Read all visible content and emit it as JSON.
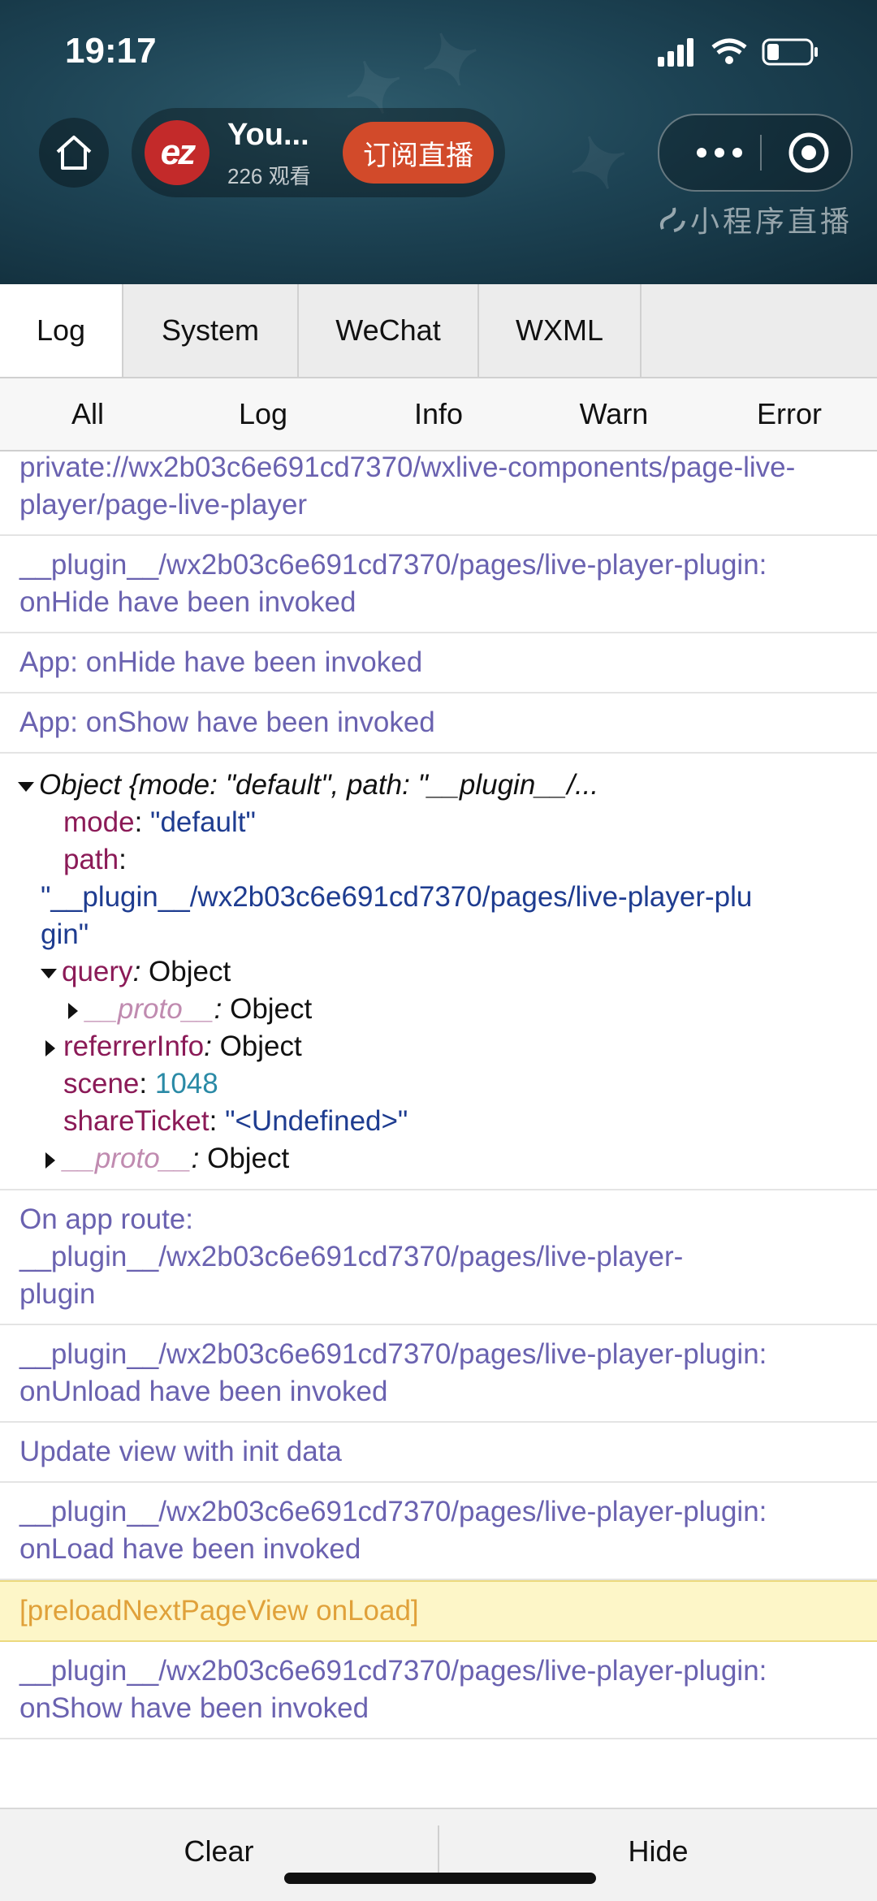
{
  "status": {
    "time": "19:17"
  },
  "live": {
    "name": "You...",
    "viewers": "226 观看",
    "subscribe_label": "订阅直播",
    "mini_label": "小程序直播",
    "avatar_text": "ez"
  },
  "tabs": [
    {
      "label": "Log",
      "active": true
    },
    {
      "label": "System",
      "active": false
    },
    {
      "label": "WeChat",
      "active": false
    },
    {
      "label": "WXML",
      "active": false
    }
  ],
  "filters": [
    "All",
    "Log",
    "Info",
    "Warn",
    "Error"
  ],
  "logs": {
    "e0": "private://wx2b03c6e691cd7370/wxlive-components/page-live-player/page-live-player",
    "e1": "__plugin__/wx2b03c6e691cd7370/pages/live-player-plugin: onHide have been invoked",
    "e2": "App: onHide have been invoked",
    "e3": "App: onShow have been invoked",
    "obj": {
      "summary": "Object {mode: \"default\", path: \"__plugin__/...",
      "mode_key": "mode",
      "mode_val": "\"default\"",
      "path_key": "path",
      "path_val": "\"__plugin__/wx2b03c6e691cd7370/pages/live-player-plugin\"",
      "query_key": "query",
      "object_word": "Object",
      "proto_key": "__proto__",
      "referrer_key": "referrerInfo",
      "scene_key": "scene",
      "scene_val": "1048",
      "share_key": "shareTicket",
      "share_val": "\"<Undefined>\""
    },
    "e5": "On app route: __plugin__/wx2b03c6e691cd7370/pages/live-player-plugin",
    "e6": "__plugin__/wx2b03c6e691cd7370/pages/live-player-plugin: onUnload have been invoked",
    "e7": "Update view with init data",
    "e8": "__plugin__/wx2b03c6e691cd7370/pages/live-player-plugin: onLoad have been invoked",
    "e9": "[preloadNextPageView onLoad]",
    "e10": "__plugin__/wx2b03c6e691cd7370/pages/live-player-plugin: onShow have been invoked"
  },
  "bottom": {
    "clear_label": "Clear",
    "hide_label": "Hide"
  },
  "colors": {
    "link": "#6a62b0",
    "warn_bg": "#fdf6c8",
    "warn_text": "#e0a13a",
    "subscribe": "#d24a2a"
  }
}
